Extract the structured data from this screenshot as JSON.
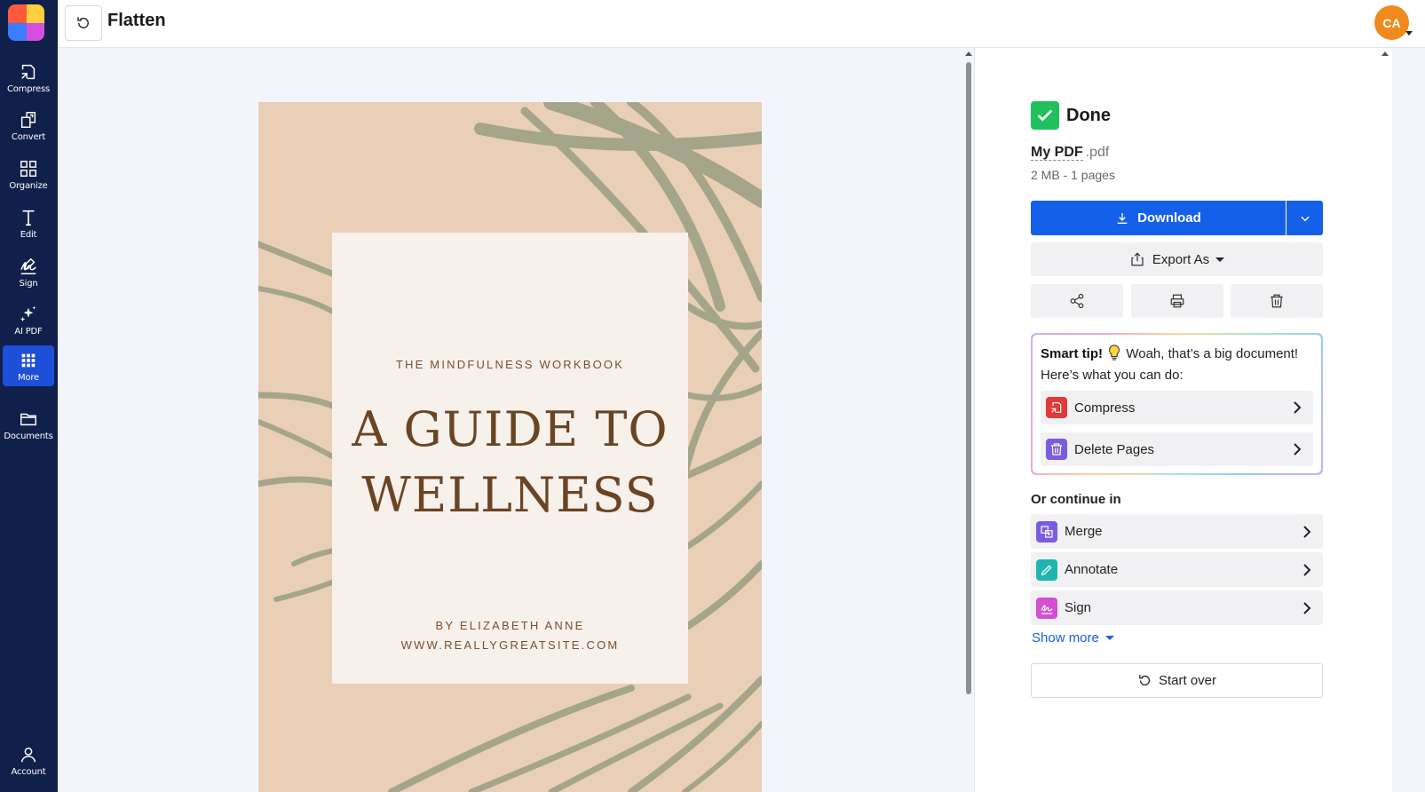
{
  "app": {
    "title": "Flatten",
    "avatar_initials": "CA"
  },
  "sidebar": {
    "items": [
      {
        "label": "Compress",
        "icon": "compress-icon"
      },
      {
        "label": "Convert",
        "icon": "convert-icon"
      },
      {
        "label": "Organize",
        "icon": "organize-icon"
      },
      {
        "label": "Edit",
        "icon": "edit-text-icon"
      },
      {
        "label": "Sign",
        "icon": "sign-icon"
      },
      {
        "label": "AI PDF",
        "icon": "sparkle-icon"
      },
      {
        "label": "More",
        "icon": "grid-icon",
        "active": true
      },
      {
        "label": "Documents",
        "icon": "folder-icon"
      },
      {
        "label": "Account",
        "icon": "user-icon"
      }
    ]
  },
  "document": {
    "subtitle": "THE MINDFULNESS WORKBOOK",
    "title_line1": "A GUIDE TO",
    "title_line2": "WELLNESS",
    "author": "BY ELIZABETH ANNE",
    "website": "WWW.REALLYGREATSITE.COM"
  },
  "panel": {
    "status": "Done",
    "file_name": "My PDF",
    "file_ext": ".pdf",
    "file_meta": "2 MB - 1 pages",
    "download_label": "Download",
    "export_label": "Export As",
    "tip_title": "Smart tip!",
    "tip_body": "Woah, that’s a big document! Here’s what you can do:",
    "tip_actions": [
      {
        "label": "Compress",
        "color": "#e03a3a"
      },
      {
        "label": "Delete Pages",
        "color": "#7b5ce0"
      }
    ],
    "continue_heading": "Or continue in",
    "continue_items": [
      {
        "label": "Merge",
        "color": "#7b5ce0"
      },
      {
        "label": "Annotate",
        "color": "#1fb6b0"
      },
      {
        "label": "Sign",
        "color": "#d64fd0"
      }
    ],
    "show_more": "Show more",
    "start_over": "Start over"
  },
  "colors": {
    "sidebar_bg": "#10204a",
    "accent": "#1560e8",
    "success": "#20c05c",
    "avatar": "#f08a1c"
  }
}
